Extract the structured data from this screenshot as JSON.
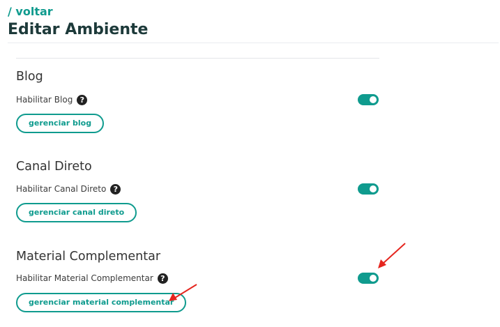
{
  "header": {
    "breadcrumb": "/ voltar",
    "title": "Editar Ambiente"
  },
  "sections": [
    {
      "title": "Blog",
      "label": "Habilitar Blog",
      "enabled": true,
      "button": "gerenciar blog"
    },
    {
      "title": "Canal Direto",
      "label": "Habilitar Canal Direto",
      "enabled": true,
      "button": "gerenciar canal direto"
    },
    {
      "title": "Material Complementar",
      "label": "Habilitar Material Complementar",
      "enabled": true,
      "button": "gerenciar material complementar"
    }
  ],
  "icons": {
    "help": "question-circle-icon",
    "annotation": "red-arrow"
  },
  "help_glyph": "?",
  "colors": {
    "accent": "#0f9b8e",
    "title": "#1d3a3a",
    "annotation": "#e5251e"
  }
}
